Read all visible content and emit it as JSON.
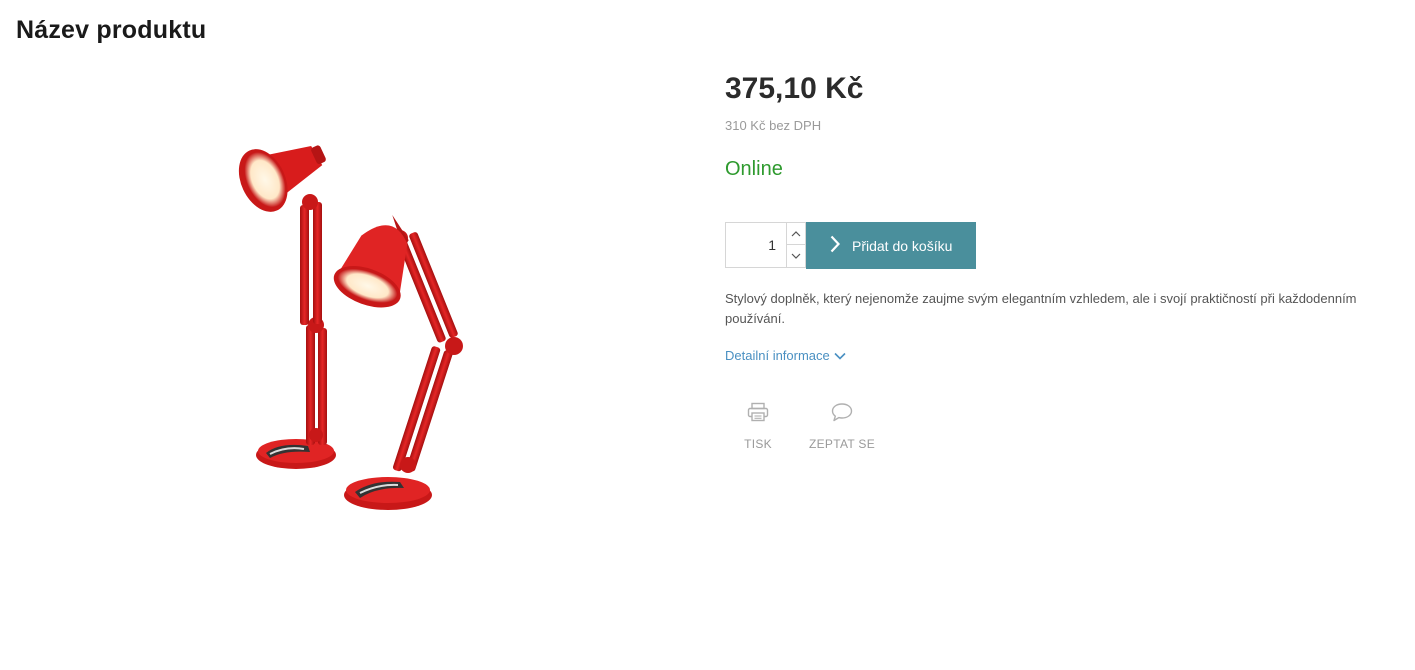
{
  "product": {
    "title": "Název produktu",
    "image_alt": "Red desk lamps",
    "price": "375,10 Kč",
    "price_net": "310 Kč bez DPH",
    "availability": "Online",
    "availability_color": "#2e9a2e",
    "quantity": "1",
    "add_to_cart_label": "Přidat do košíku",
    "accent_color": "#4a8f9c",
    "description": "Stylový doplněk, který nejenomže zaujme svým elegantním vzhledem, ale i svojí praktičností při každodenním používání.",
    "detail_link_label": "Detailní informace"
  },
  "actions": {
    "print_label": "TISK",
    "print_icon": "printer-icon",
    "ask_label": "ZEPTAT SE",
    "ask_icon": "speech-bubble-icon"
  }
}
